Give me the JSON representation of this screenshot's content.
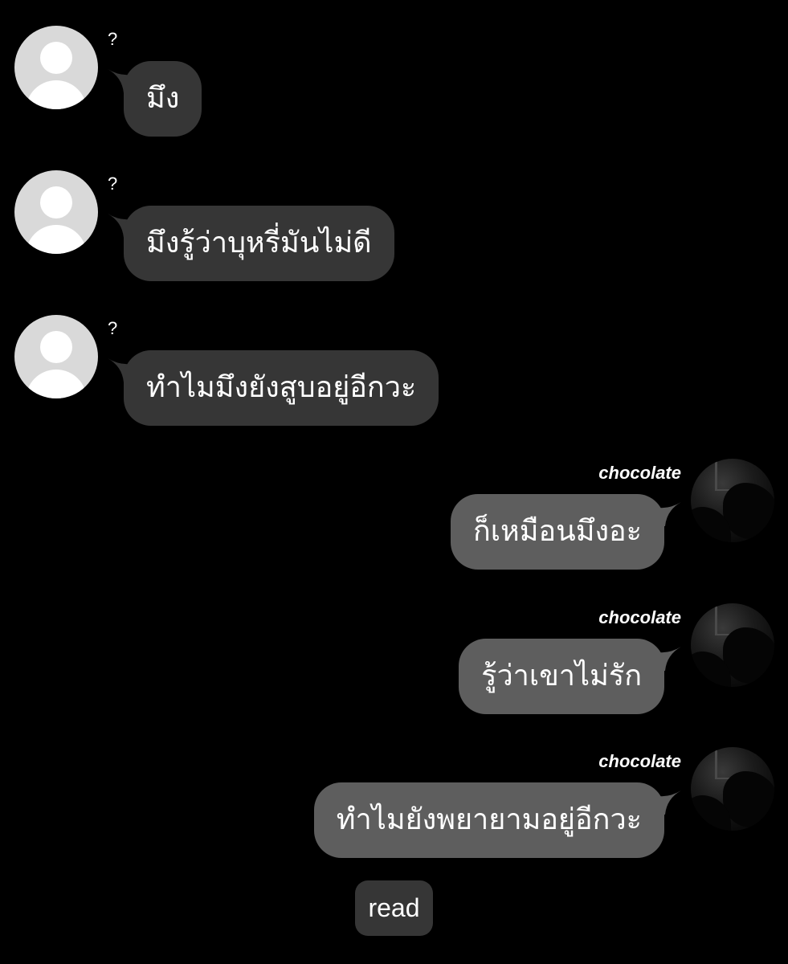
{
  "conversation": {
    "incoming": [
      {
        "sender": "?",
        "text": "มึง"
      },
      {
        "sender": "?",
        "text": "มึงรู้ว่าบุหรี่มันไม่ดี"
      },
      {
        "sender": "?",
        "text": "ทำไมมึงยังสูบอยู่อีกวะ"
      }
    ],
    "outgoing": [
      {
        "sender": "chocolate",
        "text": "ก็เหมือนมึงอะ"
      },
      {
        "sender": "chocolate",
        "text": "รู้ว่าเขาไม่รัก"
      },
      {
        "sender": "chocolate",
        "text": "ทำไมยังพยายามอยู่อีกวะ"
      }
    ],
    "read_status": "read"
  },
  "colors": {
    "background": "#000000",
    "incoming_bubble": "#363636",
    "outgoing_bubble": "#5e5e5e",
    "default_avatar": "#d9d9d9",
    "text": "#ffffff"
  },
  "icons": {
    "incoming_avatar": "default-user-icon",
    "outgoing_avatar": "user-photo"
  }
}
